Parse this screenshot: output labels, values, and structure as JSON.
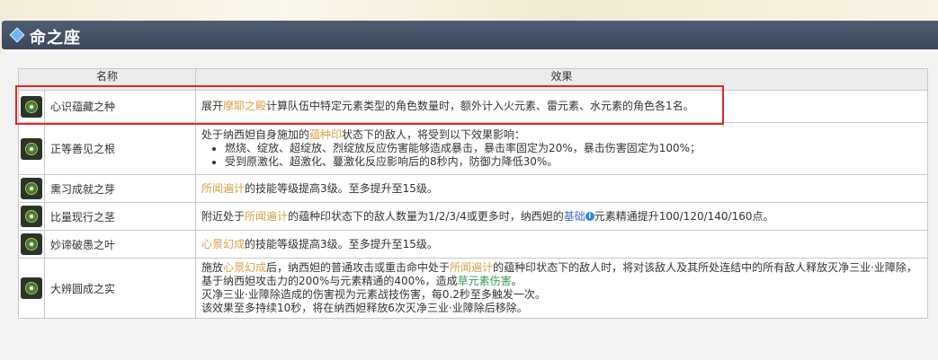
{
  "header": {
    "title": "命之座"
  },
  "table": {
    "columns": [
      "名称",
      "效果"
    ],
    "rows": [
      {
        "name": "心识蕴藏之种",
        "icon": "constellation-seed-icon",
        "effect": [
          {
            "t": "展开"
          },
          {
            "t": "摩耶之殿",
            "c": "kw"
          },
          {
            "t": "计算队伍中特定元素类型的角色数量时，额外计入火元素、雷元素、水元素的角色各1名。"
          }
        ]
      },
      {
        "name": "正等善见之根",
        "icon": "constellation-root-icon",
        "effect": [
          {
            "t": "处于纳西妲自身施加的"
          },
          {
            "t": "蕴种印",
            "c": "kw"
          },
          {
            "t": "状态下的敌人，将受到以下效果影响："
          }
        ],
        "bullets": [
          "燃烧、绽放、超绽放、烈绽放反应伤害能够造成暴击，暴击率固定为20%，暴击伤害固定为100%；",
          "受到原激化、超激化、蔓激化反应影响后的8秒内，防御力降低30%。"
        ]
      },
      {
        "name": "熏习成就之芽",
        "icon": "constellation-sprout-icon",
        "effect": [
          {
            "t": "所闻遍计",
            "c": "kw"
          },
          {
            "t": "的技能等级提高3级。至多提升至15级。"
          }
        ]
      },
      {
        "name": "比量现行之茎",
        "icon": "constellation-stem-icon",
        "effect": [
          {
            "t": "附近处于"
          },
          {
            "t": "所闻遍计",
            "c": "kw"
          },
          {
            "t": "的蕴种印状态下的敌人数量为1/2/3/4或更多时，纳西妲的"
          },
          {
            "t": "基础",
            "c": "link"
          },
          {
            "t": "i",
            "c": "info"
          },
          {
            "t": "元素精通提升100/120/140/160点。"
          }
        ]
      },
      {
        "name": "妙谛破愚之叶",
        "icon": "constellation-leaf-icon",
        "effect": [
          {
            "t": "心景幻成",
            "c": "kw"
          },
          {
            "t": "的技能等级提高3级。至多提升至15级。"
          }
        ]
      },
      {
        "name": "大辨圆成之实",
        "icon": "constellation-fruit-icon",
        "effect": [
          {
            "t": "施放"
          },
          {
            "t": "心景幻成",
            "c": "kw"
          },
          {
            "t": "后，纳西妲的普通攻击或重击命中处于"
          },
          {
            "t": "所闻遍计",
            "c": "kw"
          },
          {
            "t": "的蕴种印状态下的敌人时，将对该敌人及其所处连结中的所有敌人释放灭净三业·业障除，基于纳西妲攻击力的200%与元素精通的400%，造成"
          },
          {
            "t": "草元素伤害",
            "c": "green"
          },
          {
            "t": "。"
          },
          {
            "t": "\n灭净三业·业障除造成的伤害视为元素战技伤害，每0.2秒至多触发一次。"
          },
          {
            "t": "\n该效果至多持续10秒，将在纳西妲释放6次灭净三业·业障除后移除。"
          }
        ]
      }
    ]
  }
}
